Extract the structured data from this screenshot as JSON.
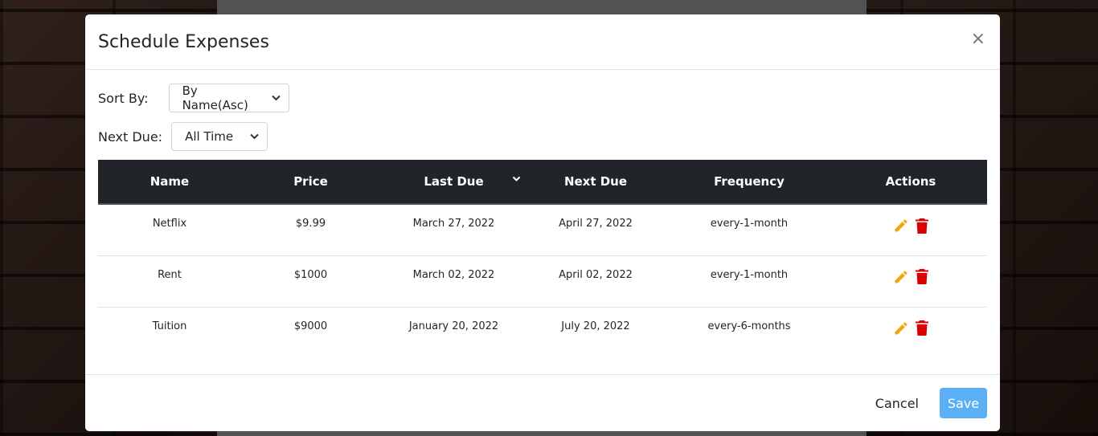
{
  "modal": {
    "title": "Schedule Expenses",
    "close_symbol": "×"
  },
  "filters": {
    "sort_by_label": "Sort By:",
    "sort_by_value": "By Name(Asc)",
    "next_due_label": "Next Due:",
    "next_due_value": "All Time"
  },
  "table": {
    "headers": {
      "name": "Name",
      "price": "Price",
      "last_due": "Last Due",
      "next_due": "Next Due",
      "frequency": "Frequency",
      "actions": "Actions"
    },
    "rows": [
      {
        "name": "Netflix",
        "price": "$9.99",
        "last_due": "March 27, 2022",
        "next_due": "April 27, 2022",
        "frequency": "every-1-month"
      },
      {
        "name": "Rent",
        "price": "$1000",
        "last_due": "March 02, 2022",
        "next_due": "April 02, 2022",
        "frequency": "every-1-month"
      },
      {
        "name": "Tuition",
        "price": "$9000",
        "last_due": "January 20, 2022",
        "next_due": "July 20, 2022",
        "frequency": "every-6-months"
      }
    ],
    "icons": {
      "edit": "pencil-icon",
      "delete": "trash-icon"
    }
  },
  "footer": {
    "cancel_label": "Cancel",
    "save_label": "Save"
  },
  "colors": {
    "header_bg": "#212529",
    "edit_icon": "#f0a30a",
    "delete_icon": "#dc0000",
    "save_button": "#5bb0f5"
  }
}
